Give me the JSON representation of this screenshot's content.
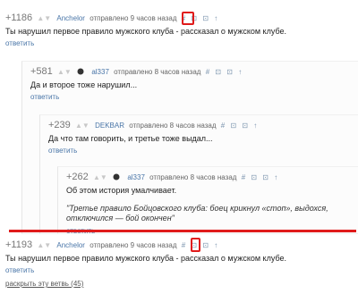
{
  "comments": [
    {
      "score": "+1186",
      "author": "Anchelor",
      "time": "отправлено 9 часов назад",
      "text": "Ты нарушил первое правило мужского клуба - рассказал о мужском клубе.",
      "reply": "ответить"
    },
    {
      "score": "+581",
      "author": "al337",
      "time": "отправлено 8 часов назад",
      "text": "Да и второе тоже нарушил...",
      "reply": "ответить"
    },
    {
      "score": "+239",
      "author": "DEKBAR",
      "time": "отправлено 8 часов назад",
      "text": "Да что там говорить, и третье тоже выдал...",
      "reply": "ответить"
    },
    {
      "score": "+262",
      "author": "al337",
      "time": "отправлено 8 часов назад",
      "text": "Об этом история умалчивает.",
      "quote": "\"Третье правило Бойцовского клуба: боец крикнул «стоп», выдохся, отключился — бой окончен\"",
      "reply": "ответить"
    },
    {
      "score": "+1193",
      "author": "Anchelor",
      "time": "отправлено 9 часов назад",
      "text": "Ты нарушил первое правило мужского клуба - рассказал о мужском клубе.",
      "reply": "ответить",
      "expand": "раскрыть эту ветвь (45)"
    }
  ],
  "icons": {
    "arrows": "▲▼",
    "actions": "# ⊡ ⊡ ↑"
  },
  "colors": {
    "link": "#4a76a8",
    "highlight": "#e01b1b"
  }
}
